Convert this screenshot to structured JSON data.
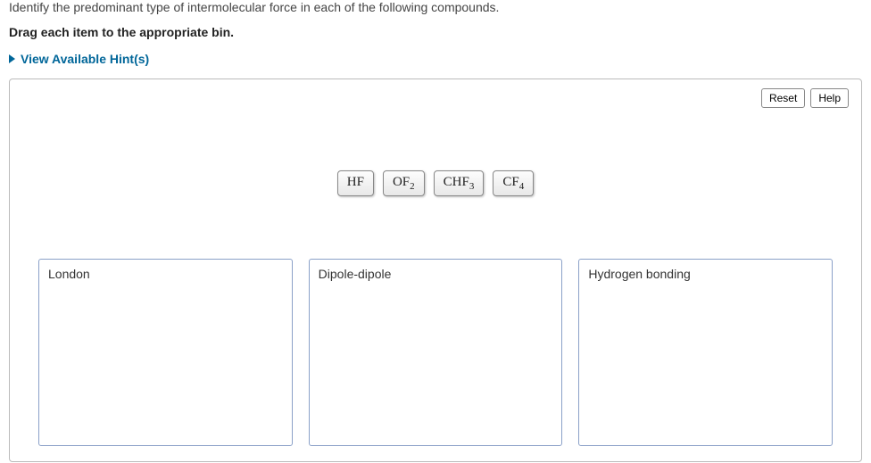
{
  "question": "Identify the predominant type of intermolecular force in each of the following compounds.",
  "instruction": "Drag each item to the appropriate bin.",
  "hints_label": "View Available Hint(s)",
  "toolbar": {
    "reset": "Reset",
    "help": "Help"
  },
  "items": [
    {
      "main": "HF",
      "sub": ""
    },
    {
      "main": "OF",
      "sub": "2"
    },
    {
      "main": "CHF",
      "sub": "3"
    },
    {
      "main": "CF",
      "sub": "4"
    }
  ],
  "bins": [
    {
      "label": "London"
    },
    {
      "label": "Dipole-dipole"
    },
    {
      "label": "Hydrogen bonding"
    }
  ]
}
